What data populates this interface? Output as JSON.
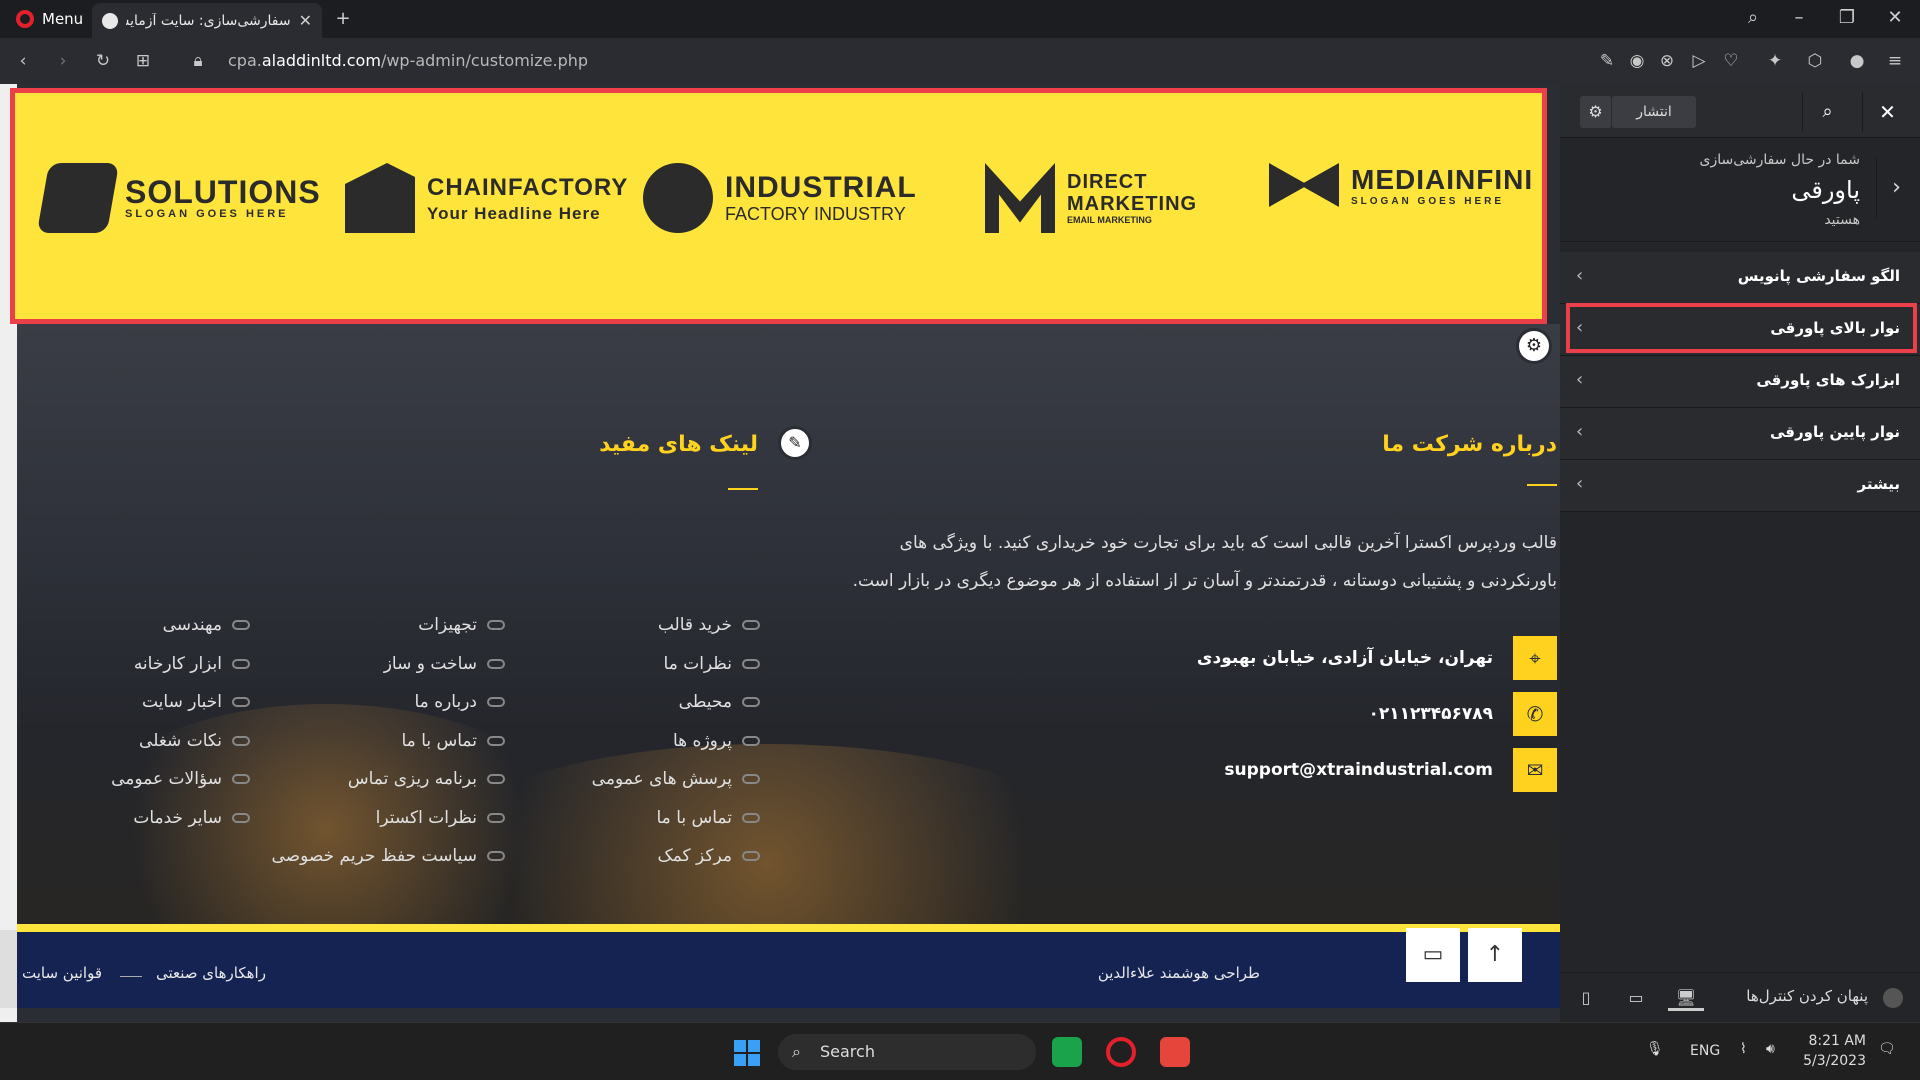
{
  "browser": {
    "menu_label": "Menu",
    "tab_title": "سفارشی‌سازی: سایت آزمایشی علاءالدین",
    "new_tab": "+",
    "url_prefix": "cpa.",
    "url_domain": "aladdinltd.com",
    "url_path": "/wp-admin/customize.php"
  },
  "banner": {
    "logos": [
      {
        "name": "SOLUTIONS",
        "tagline": "SLOGAN GOES HERE"
      },
      {
        "name": "CHAINFACTORY",
        "tagline": "Your Headline Here"
      },
      {
        "name": "INDUSTRIAL",
        "tagline": "FACTORY INDUSTRY"
      },
      {
        "name": "DIRECT",
        "name2": "MARKETING",
        "tagline": "EMAIL MARKETING"
      },
      {
        "name": "MEDIAINFINI",
        "tagline": "SLOGAN GOES HERE"
      }
    ]
  },
  "footer": {
    "about_heading": "درباره شرکت ما",
    "about_text": "قالب وردپرس اکسترا آخرین قالبی است که باید برای تجارت خود خریداری کنید. با ویژگی های باورنکردنی و پشتیبانی دوستانه ، قدرتمندتر و آسان تر از استفاده از هر موضوع دیگری در بازار است.",
    "address": "تهران، خیابان آزادی، خیابان بهبودی",
    "phone": "۰۲۱۱۲۳۴۵۶۷۸۹",
    "email": "support@xtraindustrial.com",
    "links_heading": "لینک های مفید",
    "links_col1": [
      "خرید قالب",
      "نظرات ما",
      "محیطی",
      "پروژه ها",
      "پرسش های عمومی",
      "تماس با ما",
      "مرکز کمک"
    ],
    "links_col2": [
      "تجهیزات",
      "ساخت و ساز",
      "درباره ما",
      "تماس با ما",
      "برنامه ریزی تماس",
      "نظرات اکسترا",
      "سیاست حفظ حریم خصوصی"
    ],
    "links_col3": [
      "مهندسی",
      "ابزار کارخانه",
      "اخبار سایت",
      "نکات شغلی",
      "سؤالات عمومی",
      "سایر خدمات"
    ],
    "bottom_right": "طراحی هوشمند علاءالدین",
    "bottom_left_1": "قوانین سایت",
    "bottom_left_2": "راهکارهای صنعتی"
  },
  "sidebar": {
    "publish_label": "انتشار",
    "info_small": "شما در حال سفارشی‌سازی",
    "info_big": "پاورقی",
    "info_small2": "هستید",
    "items": [
      {
        "label": "الگو سفارشی پانویس"
      },
      {
        "label": "نوار بالای پاورقی"
      },
      {
        "label": "ابزارک های پاورقی"
      },
      {
        "label": "نوار پایین پاورقی"
      },
      {
        "label": "بیشتر"
      }
    ],
    "hide_controls": "پنهان کردن کنترل‌ها"
  },
  "taskbar": {
    "search_label": "Search",
    "lang": "ENG",
    "time": "8:21 AM",
    "date": "5/3/2023"
  },
  "colors": {
    "accent_yellow": "#ffd21f",
    "banner_yellow": "#ffe53b",
    "highlight_red": "#ec3f4a",
    "footer_blue": "#152353"
  }
}
